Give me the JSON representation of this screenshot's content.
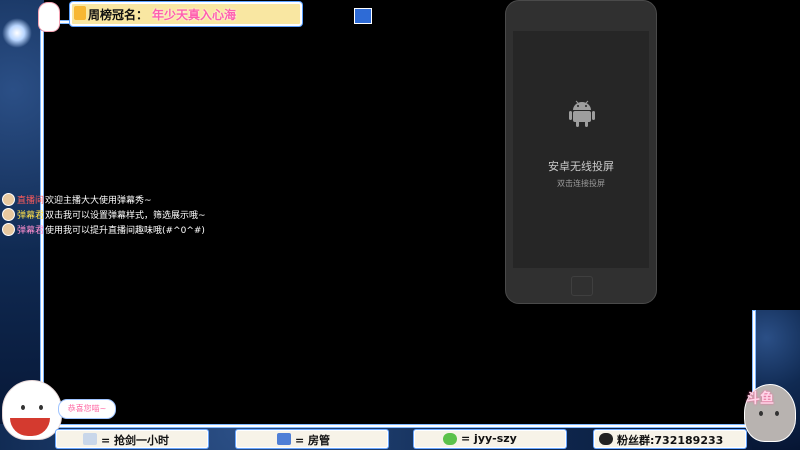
{
  "top_banner": {
    "label": "周榜冠名：",
    "marquee": "年少天真入心海"
  },
  "chat": {
    "messages": [
      {
        "name": "直播间",
        "text": "欢迎主播大大使用弹幕秀~",
        "name_color": "#ff5a5a"
      },
      {
        "name": "弹幕君",
        "text": "双击我可以设置弹幕样式，筛选展示哦~",
        "name_color": "#ffe14a"
      },
      {
        "name": "弹幕君",
        "text": "使用我可以提升直播间趣味哦(#^0^#)",
        "name_color": "#ff8fd0"
      }
    ]
  },
  "phone": {
    "title": "安卓无线投屏",
    "subtitle": "双击连接投屏"
  },
  "bubble": {
    "text": "恭喜您喵~"
  },
  "bottom_panels": [
    {
      "text": "= 抢剑一小时"
    },
    {
      "text": "= 房管"
    },
    {
      "text": "= jyy-szy"
    },
    {
      "text": "粉丝群:732189233"
    }
  ],
  "watermark": {
    "text": "斗鱼"
  },
  "colors": {
    "frame_dark": "#061533",
    "frame_light": "#2b4f86",
    "phone_body": "#303030",
    "phone_screen": "#262626"
  }
}
